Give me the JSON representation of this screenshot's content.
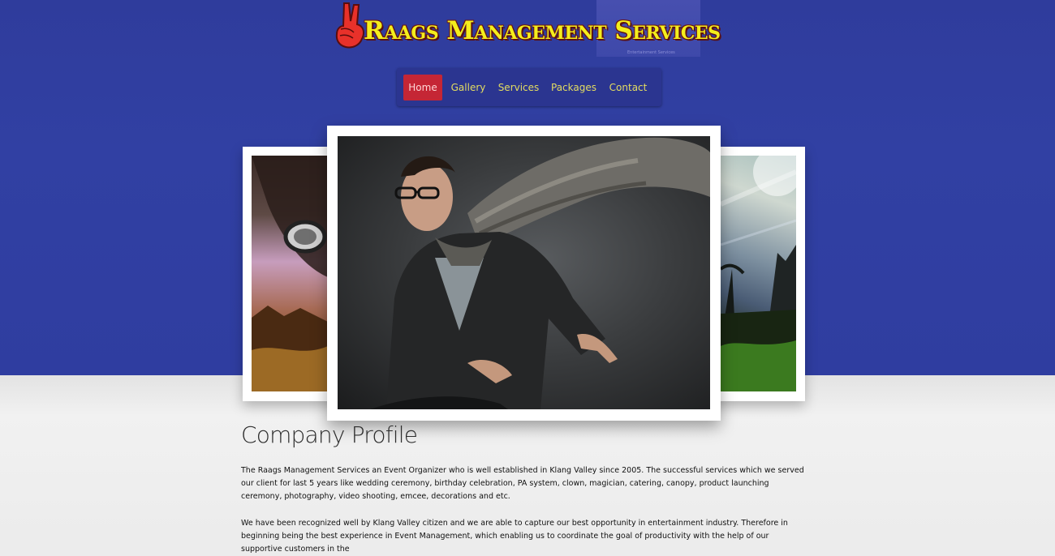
{
  "logo": {
    "title": "Raags Management Services",
    "tagline": "Entertainment Services",
    "hand_icon": "victory-hand-icon"
  },
  "nav": {
    "items": [
      {
        "label": "Home",
        "active": true
      },
      {
        "label": "Gallery",
        "active": false
      },
      {
        "label": "Services",
        "active": false
      },
      {
        "label": "Packages",
        "active": false
      },
      {
        "label": "Contact",
        "active": false
      }
    ]
  },
  "slider": {
    "slides": [
      "left-portrait",
      "main-portrait",
      "right-landscape"
    ]
  },
  "profile": {
    "title": "Company Profile",
    "paragraph1": "The Raags Management Services an Event Organizer who is well established in Klang Valley since 2005. The successful services which we served our client for last 5 years like wedding ceremony, birthday celebration, PA system, clown, magician, catering, canopy, product launching ceremony, photography, video shooting, emcee, decorations and etc.",
    "paragraph2": "We have been recognized well by Klang Valley citizen and we are able to capture our best opportunity in entertainment industry. Therefore in beginning being the best experience in Event Management, which enabling us to coordinate the goal of productivity with the help of our supportive customers in the"
  },
  "colors": {
    "top_band": "#3140a3",
    "nav_bg": "#2b3590",
    "nav_active": "#c52635",
    "nav_text": "#e3dc61",
    "logo_text": "#f4ee1c"
  }
}
